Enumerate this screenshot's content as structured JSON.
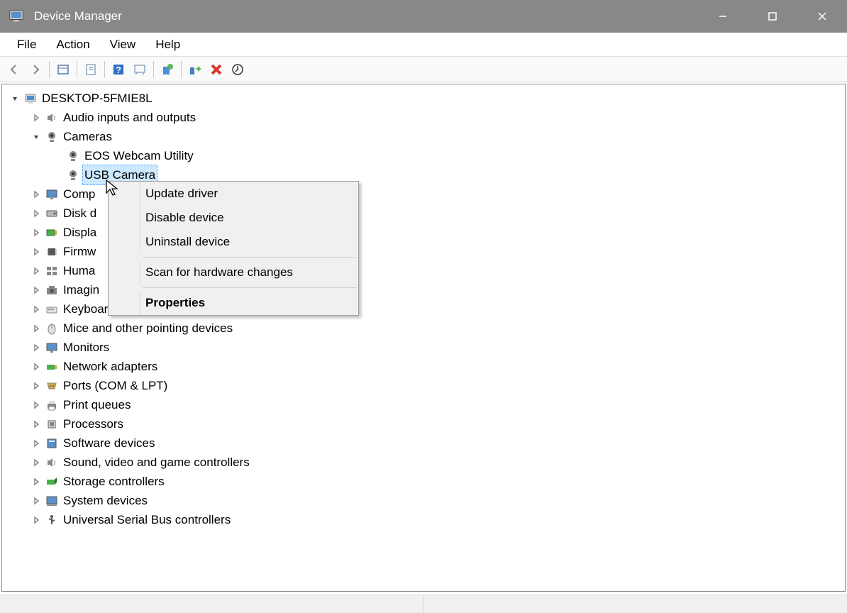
{
  "window": {
    "title": "Device Manager"
  },
  "menu": {
    "file": "File",
    "action": "Action",
    "view": "View",
    "help": "Help"
  },
  "tree": {
    "root": "DESKTOP-5FMIE8L",
    "items": [
      {
        "label": "Audio inputs and outputs",
        "expanded": false
      },
      {
        "label": "Cameras",
        "expanded": true,
        "children": [
          {
            "label": "EOS Webcam Utility"
          },
          {
            "label": "USB Camera",
            "selected": true
          }
        ]
      },
      {
        "label": "Computer",
        "expanded": false,
        "clip": "Comp"
      },
      {
        "label": "Disk drives",
        "expanded": false,
        "clip": "Disk d"
      },
      {
        "label": "Display adapters",
        "expanded": false,
        "clip": "Displa"
      },
      {
        "label": "Firmware",
        "expanded": false,
        "clip": "Firmw"
      },
      {
        "label": "Human Interface Devices",
        "expanded": false,
        "clip": "Huma"
      },
      {
        "label": "Imaging devices",
        "expanded": false,
        "clip": "Imagin"
      },
      {
        "label": "Keyboards",
        "expanded": false,
        "clip": "Keyboards"
      },
      {
        "label": "Mice and other pointing devices",
        "expanded": false
      },
      {
        "label": "Monitors",
        "expanded": false
      },
      {
        "label": "Network adapters",
        "expanded": false
      },
      {
        "label": "Ports (COM & LPT)",
        "expanded": false
      },
      {
        "label": "Print queues",
        "expanded": false
      },
      {
        "label": "Processors",
        "expanded": false
      },
      {
        "label": "Software devices",
        "expanded": false
      },
      {
        "label": "Sound, video and game controllers",
        "expanded": false
      },
      {
        "label": "Storage controllers",
        "expanded": false
      },
      {
        "label": "System devices",
        "expanded": false
      },
      {
        "label": "Universal Serial Bus controllers",
        "expanded": false
      }
    ]
  },
  "context_menu": {
    "update": "Update driver",
    "disable": "Disable device",
    "uninstall": "Uninstall device",
    "scan": "Scan for hardware changes",
    "properties": "Properties"
  }
}
